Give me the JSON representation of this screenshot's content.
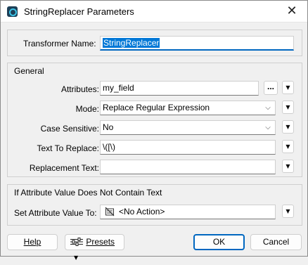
{
  "window": {
    "title": "StringReplacer Parameters",
    "close_glyph": "✕",
    "icon": "fme-app-icon"
  },
  "transformer": {
    "label": "Transformer Name:",
    "value": "StringReplacer"
  },
  "general": {
    "title": "General",
    "attributes": {
      "label": "Attributes:",
      "value": "my_field",
      "browse": "..."
    },
    "mode": {
      "label": "Mode:",
      "value": "Replace Regular Expression"
    },
    "case_sensitive": {
      "label": "Case Sensitive:",
      "value": "No"
    },
    "text_to_replace": {
      "label": "Text To Replace:",
      "value": "\\([\\)"
    },
    "replacement_text": {
      "label": "Replacement Text:",
      "value": ""
    }
  },
  "noattr": {
    "title": "If Attribute Value Does Not Contain Text",
    "set_value": {
      "label": "Set Attribute Value To:",
      "value": "<No Action>",
      "icon": "no-action-icon"
    }
  },
  "buttons": {
    "help": "Help",
    "presets": "Presets",
    "ok": "OK",
    "cancel": "Cancel"
  },
  "glyphs": {
    "menu_arrow": "▼",
    "combo_chevron": "⌵"
  }
}
